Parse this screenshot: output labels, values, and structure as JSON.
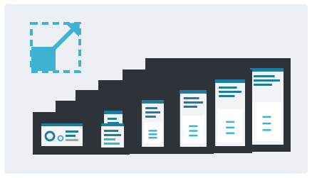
{
  "colors": {
    "background": "#ecf0f5",
    "accent": "#3bb3d1",
    "frame": "#2d3338",
    "screen": "#f2f4f6",
    "accent_dark": "#1d7da0",
    "line_gray": "#9ea6ad"
  },
  "icons": {
    "expand": "resize-arrow-icon"
  },
  "devices": [
    {
      "name": "device-size-7"
    },
    {
      "name": "device-size-6"
    },
    {
      "name": "device-size-5"
    },
    {
      "name": "device-size-4"
    },
    {
      "name": "device-size-3"
    },
    {
      "name": "device-size-2"
    },
    {
      "name": "device-size-1"
    }
  ]
}
